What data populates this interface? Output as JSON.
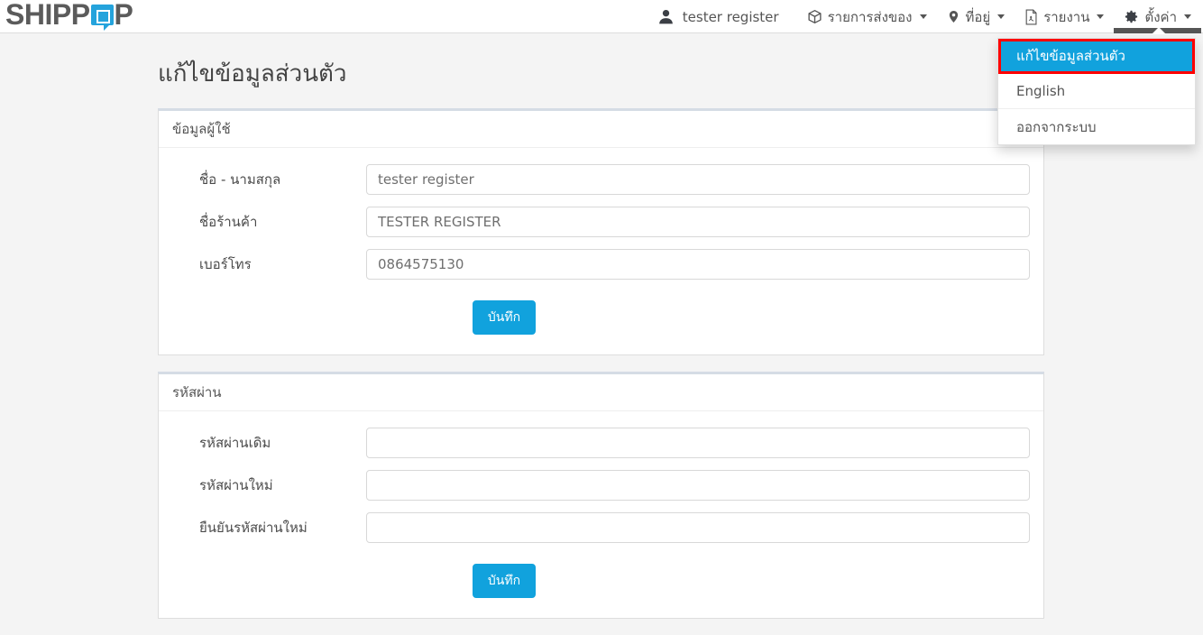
{
  "brand": {
    "text_before": "SHIPP",
    "icon": "chat-bubble-icon",
    "text_after": "P",
    "accent": "#24a3dc"
  },
  "navbar": {
    "user": {
      "label": "tester register",
      "icon": "user-icon"
    },
    "items": [
      {
        "label": "รายการส่งของ",
        "icon": "box-icon",
        "active": false
      },
      {
        "label": "ที่อยู่",
        "icon": "map-marker-icon",
        "active": false
      },
      {
        "label": "รายงาน",
        "icon": "pdf-file-icon",
        "active": false
      },
      {
        "label": "ตั้งค่า",
        "icon": "gear-icon",
        "active": true
      }
    ]
  },
  "dropdown": {
    "items": [
      {
        "label": "แก้ไขข้อมูลส่วนตัว",
        "highlighted": true
      },
      {
        "label": "English",
        "highlighted": false
      },
      {
        "label": "ออกจากระบบ",
        "highlighted": false
      }
    ],
    "highlight_bg": "#11a2dd",
    "highlight_outline": "#ff0000"
  },
  "page": {
    "title": "แก้ไขข้อมูลส่วนตัว"
  },
  "user_panel": {
    "heading": "ข้อมูลผู้ใช้",
    "fields": [
      {
        "label": "ชื่อ - นามสกุล",
        "value": "tester register",
        "placeholder": ""
      },
      {
        "label": "ชื่อร้านค้า",
        "value": "TESTER REGISTER",
        "placeholder": ""
      },
      {
        "label": "เบอร์โทร",
        "value": "0864575130",
        "placeholder": ""
      }
    ],
    "save_label": "บันทึก"
  },
  "password_panel": {
    "heading": "รหัสผ่าน",
    "fields": [
      {
        "label": "รหัสผ่านเดิม",
        "value": "",
        "placeholder": ""
      },
      {
        "label": "รหัสผ่านใหม่",
        "value": "",
        "placeholder": ""
      },
      {
        "label": "ยืนยันรหัสผ่านใหม่",
        "value": "",
        "placeholder": ""
      }
    ],
    "save_label": "บันทึก"
  }
}
